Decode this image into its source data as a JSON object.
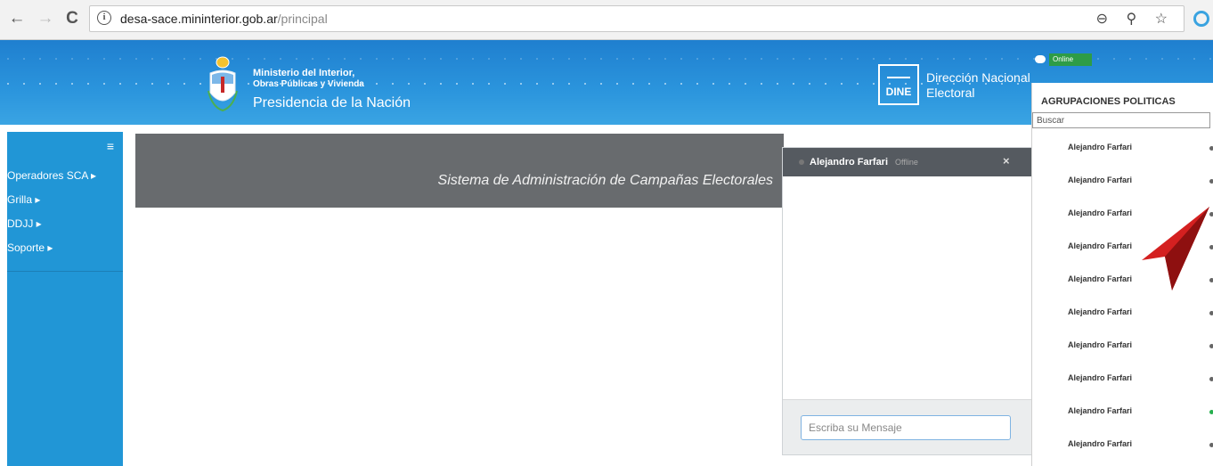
{
  "browser": {
    "back": "←",
    "forward": "→",
    "reload": "C",
    "info_glyph": "i",
    "url_host": "desa-sace.mininterior.gob.ar",
    "url_path": "/principal",
    "icons": "⊖ ⚲ ☆"
  },
  "banner": {
    "ministry_line1": "Ministerio del Interior,",
    "ministry_line2": "Obras Públicas y Vivienda",
    "ministry_line3": "Presidencia de la Nación",
    "dine_label": "DINE",
    "direction_line1": "Dirección Nacional",
    "direction_line2": "Electoral"
  },
  "sidebar": {
    "hamburger": "≡",
    "items": [
      {
        "label": "Operadores SCA ▸"
      },
      {
        "label": "Grilla ▸"
      },
      {
        "label": "DDJJ ▸"
      },
      {
        "label": "Soporte ▸"
      }
    ]
  },
  "header": {
    "title": "Sistema de Administración de Campañas Electorales"
  },
  "chat": {
    "contact_name": "Alejandro Farfari",
    "status": "Offline",
    "close": "×",
    "input_placeholder": "Escriba su Mensaje"
  },
  "presence": {
    "status": "Online"
  },
  "panel": {
    "title": "AGRUPACIONES POLITICAS",
    "search_placeholder": "Buscar",
    "contacts": [
      {
        "name": "Alejandro Farfari",
        "online": false
      },
      {
        "name": "Alejandro Farfari",
        "online": false
      },
      {
        "name": "Alejandro Farfari",
        "online": false
      },
      {
        "name": "Alejandro Farfari",
        "online": false
      },
      {
        "name": "Alejandro Farfari",
        "online": false
      },
      {
        "name": "Alejandro Farfari",
        "online": false
      },
      {
        "name": "Alejandro Farfari",
        "online": false
      },
      {
        "name": "Alejandro Farfari",
        "online": false
      },
      {
        "name": "Alejandro Farfari",
        "online": true
      },
      {
        "name": "Alejandro Farfari",
        "online": false
      }
    ]
  },
  "colors": {
    "banner_blue": "#2b95dd",
    "sidebar_blue": "#2196d6",
    "header_gray": "#686b6e",
    "chat_header": "#555a60",
    "online_green": "#2e9c46",
    "arrow_red": "#d42020"
  }
}
